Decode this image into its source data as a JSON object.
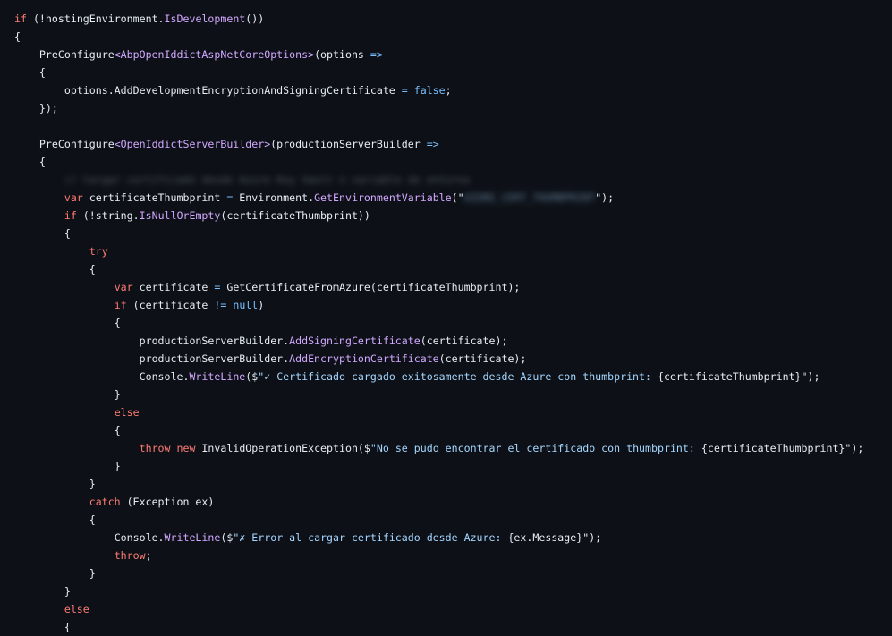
{
  "code_lines": [
    "if (!hostingEnvironment.IsDevelopment())",
    "{",
    "    PreConfigure<AbpOpenIddictAspNetCoreOptions>(options =>",
    "    {",
    "        options.AddDevelopmentEncryptionAndSigningCertificate = false;",
    "    });",
    "",
    "    PreConfigure<OpenIddictServerBuilder>(productionServerBuilder =>",
    "    {",
    "        // Cargar certificado desde Azure Key Vault o variable de entorno",
    "        var certificateThumbprint = Environment.GetEnvironmentVariable(\"AZURE_CERT_THUMBPRINT\");",
    "        if (!string.IsNullOrEmpty(certificateThumbprint))",
    "        {",
    "            try",
    "            {",
    "                var certificate = GetCertificateFromAzure(certificateThumbprint);",
    "                if (certificate != null)",
    "                {",
    "                    productionServerBuilder.AddSigningCertificate(certificate);",
    "                    productionServerBuilder.AddEncryptionCertificate(certificate);",
    "                    Console.WriteLine($\"✓ Certificado cargado exitosamente desde Azure con thumbprint: {certificateThumbprint}\");",
    "                }",
    "                else",
    "                {",
    "                    throw new InvalidOperationException($\"No se pudo encontrar el certificado con thumbprint: {certificateThumbprint}\");",
    "                }",
    "            }",
    "            catch (Exception ex)",
    "            {",
    "                Console.WriteLine($\"✗ Error al cargar certificado desde Azure: {ex.Message}\");",
    "                throw;",
    "            }",
    "        }",
    "        else",
    "        {"
  ],
  "tokens": {
    "if_kw": "if",
    "else_kw": "else",
    "try_kw": "try",
    "catch_kw": "catch",
    "var_kw": "var",
    "throw_kw": "throw",
    "new_kw": "new",
    "null_kw": "null",
    "false_kw": "false",
    "lambda": "=>",
    "assign": "=",
    "neq": "!=",
    "open_brace": "{",
    "close_brace": "}",
    "close_lambda": "});",
    "hosting_env": "(!hostingEnvironment.",
    "is_development": "IsDevelopment",
    "close_paren2": "())",
    "preconfigure": "PreConfigure",
    "generic_1": "<AbpOpenIddictAspNetCoreOptions>",
    "options_param": "(options ",
    "options_prop": "options.AddDevelopmentEncryptionAndSigningCertificate ",
    "semicolon": ";",
    "generic_2": "<OpenIddictServerBuilder>",
    "psb_param": "(productionServerBuilder ",
    "redacted_comment": "// Cargar certificado desde Azure Key Vault o variable de entorno",
    "cert_thumb_decl": " certificateThumbprint ",
    "environment": " Environment.",
    "get_env_var": "GetEnvironmentVariable",
    "open_paren_quote": "(\"",
    "redacted_string": "AZURE_CERT_THUMBPRINT",
    "close_quote_paren": "\");",
    "not_string": " (!string.",
    "is_null_or_empty": "IsNullOrEmpty",
    "cert_thumb_arg": "(certificateThumbprint))",
    "certificate_decl": " certificate ",
    "get_cert_call": " GetCertificateFromAzure(certificateThumbprint);",
    "cert_cond_open": " (certificate ",
    "cond_close": ")",
    "psb_dot": "productionServerBuilder.",
    "add_signing": "AddSigningCertificate",
    "add_encryption": "AddEncryptionCertificate",
    "cert_arg": "(certificate);",
    "console_dot": "Console.",
    "write_line": "WriteLine",
    "interp_open": "($",
    "success_msg": "\"✓ Certificado cargado exitosamente desde Azure con thumbprint: ",
    "thumb_interp": "{certificateThumbprint}",
    "interp_close": "\");",
    "invalid_op_exc": " InvalidOperationException($",
    "not_found_msg": "\"No se pudo encontrar el certificado con thumbprint: ",
    "exception_param": " (Exception ex)",
    "error_msg": "\"✗ Error al cargar certificado desde Azure: ",
    "ex_message": "{ex.Message}"
  }
}
